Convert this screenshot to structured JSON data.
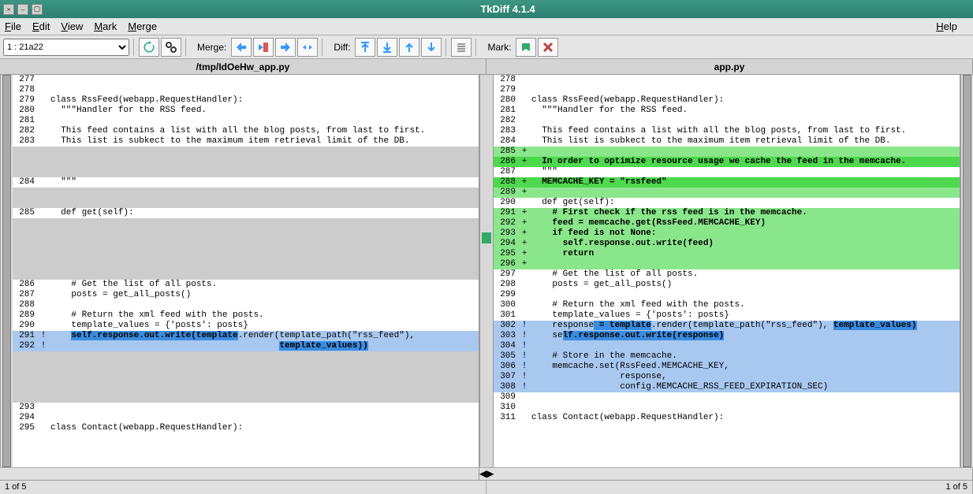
{
  "window": {
    "title": "TkDiff 4.1.4"
  },
  "menu": {
    "file": "File",
    "edit": "Edit",
    "view": "View",
    "mark": "Mark",
    "merge": "Merge",
    "help": "Help"
  },
  "toolbar": {
    "diff_selector": "1    : 21a22",
    "merge_label": "Merge:",
    "diff_label": "Diff:",
    "mark_label": "Mark:"
  },
  "files": {
    "left": "/tmp/IdOeHw_app.py",
    "right": "app.py"
  },
  "status": {
    "left": "1 of 5",
    "right": "1 of 5"
  },
  "left_lines": [
    {
      "n": "277",
      "m": "",
      "t": "",
      "bg": ""
    },
    {
      "n": "278",
      "m": "",
      "t": "",
      "bg": ""
    },
    {
      "n": "279",
      "m": "",
      "t": "class RssFeed(webapp.RequestHandler):",
      "bg": ""
    },
    {
      "n": "280",
      "m": "",
      "t": "  \"\"\"Handler for the RSS feed.",
      "bg": ""
    },
    {
      "n": "281",
      "m": "",
      "t": "",
      "bg": ""
    },
    {
      "n": "282",
      "m": "",
      "t": "  This feed contains a list with all the blog posts, from last to first.",
      "bg": ""
    },
    {
      "n": "283",
      "m": "",
      "t": "  This list is subkect to the maximum item retrieval limit of the DB.",
      "bg": ""
    },
    {
      "n": "",
      "m": "",
      "t": "",
      "bg": "bg-pad"
    },
    {
      "n": "",
      "m": "",
      "t": "",
      "bg": "bg-pad"
    },
    {
      "n": "",
      "m": "",
      "t": "",
      "bg": "bg-pad"
    },
    {
      "n": "284",
      "m": "",
      "t": "  \"\"\"",
      "bg": ""
    },
    {
      "n": "",
      "m": "",
      "t": "",
      "bg": "bg-pad"
    },
    {
      "n": "",
      "m": "",
      "t": "",
      "bg": "bg-pad"
    },
    {
      "n": "285",
      "m": "",
      "t": "  def get(self):",
      "bg": ""
    },
    {
      "n": "",
      "m": "",
      "t": "",
      "bg": "bg-pad"
    },
    {
      "n": "",
      "m": "",
      "t": "",
      "bg": "bg-pad"
    },
    {
      "n": "",
      "m": "",
      "t": "",
      "bg": "bg-pad"
    },
    {
      "n": "",
      "m": "",
      "t": "",
      "bg": "bg-pad"
    },
    {
      "n": "",
      "m": "",
      "t": "",
      "bg": "bg-pad"
    },
    {
      "n": "",
      "m": "",
      "t": "",
      "bg": "bg-pad"
    },
    {
      "n": "286",
      "m": "",
      "t": "    # Get the list of all posts.",
      "bg": ""
    },
    {
      "n": "287",
      "m": "",
      "t": "    posts = get_all_posts()",
      "bg": ""
    },
    {
      "n": "288",
      "m": "",
      "t": "",
      "bg": ""
    },
    {
      "n": "289",
      "m": "",
      "t": "    # Return the xml feed with the posts.",
      "bg": ""
    },
    {
      "n": "290",
      "m": "",
      "t": "    template_values = {'posts': posts}",
      "bg": ""
    },
    {
      "n": "291",
      "m": "!",
      "t": "",
      "bg": "bg-chg",
      "spans": [
        {
          "t": "    ",
          "c": ""
        },
        {
          "t": "self.response.out.write(template",
          "c": "hl-strong"
        },
        {
          "t": ".render(template_path(\"rss_feed\"),",
          "c": ""
        }
      ]
    },
    {
      "n": "292",
      "m": "!",
      "t": "",
      "bg": "bg-chg",
      "spans": [
        {
          "t": "                                            ",
          "c": ""
        },
        {
          "t": "template_values)",
          "c": "hl-strong"
        },
        {
          "t": ")",
          "c": "hl-strong"
        }
      ]
    },
    {
      "n": "",
      "m": "",
      "t": "",
      "bg": "bg-pad"
    },
    {
      "n": "",
      "m": "",
      "t": "",
      "bg": "bg-pad"
    },
    {
      "n": "",
      "m": "",
      "t": "",
      "bg": "bg-pad"
    },
    {
      "n": "",
      "m": "",
      "t": "",
      "bg": "bg-pad"
    },
    {
      "n": "",
      "m": "",
      "t": "",
      "bg": "bg-pad"
    },
    {
      "n": "293",
      "m": "",
      "t": "",
      "bg": ""
    },
    {
      "n": "294",
      "m": "",
      "t": "",
      "bg": ""
    },
    {
      "n": "295",
      "m": "",
      "t": "class Contact(webapp.RequestHandler):",
      "bg": ""
    }
  ],
  "right_lines": [
    {
      "n": "278",
      "m": "",
      "t": "",
      "bg": ""
    },
    {
      "n": "279",
      "m": "",
      "t": "",
      "bg": ""
    },
    {
      "n": "280",
      "m": "",
      "t": "class RssFeed(webapp.RequestHandler):",
      "bg": ""
    },
    {
      "n": "281",
      "m": "",
      "t": "  \"\"\"Handler for the RSS feed.",
      "bg": ""
    },
    {
      "n": "282",
      "m": "",
      "t": "",
      "bg": ""
    },
    {
      "n": "283",
      "m": "",
      "t": "  This feed contains a list with all the blog posts, from last to first.",
      "bg": ""
    },
    {
      "n": "284",
      "m": "",
      "t": "  This list is subkect to the maximum item retrieval limit of the DB.",
      "bg": ""
    },
    {
      "n": "285",
      "m": "+",
      "t": "",
      "bg": "bg-add"
    },
    {
      "n": "286",
      "m": "+",
      "t": "  In order to optimize resource usage we cache the feed in the memcache.",
      "bg": "bg-add-strong",
      "bold": true
    },
    {
      "n": "287",
      "m": "",
      "t": "  \"\"\"",
      "bg": ""
    },
    {
      "n": "288",
      "m": "+",
      "t": "  MEMCACHE_KEY = \"rssfeed\"",
      "bg": "bg-add-strong",
      "bold": true
    },
    {
      "n": "289",
      "m": "+",
      "t": "",
      "bg": "bg-add"
    },
    {
      "n": "290",
      "m": "",
      "t": "  def get(self):",
      "bg": ""
    },
    {
      "n": "291",
      "m": "+",
      "t": "    # First check if the rss feed is in the memcache.",
      "bg": "bg-add",
      "bold": true
    },
    {
      "n": "292",
      "m": "+",
      "t": "    feed = memcache.get(RssFeed.MEMCACHE_KEY)",
      "bg": "bg-add",
      "bold": true
    },
    {
      "n": "293",
      "m": "+",
      "t": "    if feed is not None:",
      "bg": "bg-add",
      "bold": true
    },
    {
      "n": "294",
      "m": "+",
      "t": "      self.response.out.write(feed)",
      "bg": "bg-add",
      "bold": true
    },
    {
      "n": "295",
      "m": "+",
      "t": "      return",
      "bg": "bg-add",
      "bold": true
    },
    {
      "n": "296",
      "m": "+",
      "t": "",
      "bg": "bg-add"
    },
    {
      "n": "297",
      "m": "",
      "t": "    # Get the list of all posts.",
      "bg": ""
    },
    {
      "n": "298",
      "m": "",
      "t": "    posts = get_all_posts()",
      "bg": ""
    },
    {
      "n": "299",
      "m": "",
      "t": "",
      "bg": ""
    },
    {
      "n": "300",
      "m": "",
      "t": "    # Return the xml feed with the posts.",
      "bg": ""
    },
    {
      "n": "301",
      "m": "",
      "t": "    template_values = {'posts': posts}",
      "bg": ""
    },
    {
      "n": "302",
      "m": "!",
      "t": "",
      "bg": "bg-chg",
      "spans": [
        {
          "t": "    response",
          "c": ""
        },
        {
          "t": " = template",
          "c": "hl-strong"
        },
        {
          "t": ".render(template_path(\"rss_feed\"), ",
          "c": ""
        },
        {
          "t": "template_values)",
          "c": "hl-strong"
        }
      ]
    },
    {
      "n": "303",
      "m": "!",
      "t": "",
      "bg": "bg-chg",
      "spans": [
        {
          "t": "    se",
          "c": ""
        },
        {
          "t": "lf.re",
          "c": "hl-strong"
        },
        {
          "t": "sponse.out.write(response)",
          "c": "hl-strong"
        }
      ]
    },
    {
      "n": "304",
      "m": "!",
      "t": "",
      "bg": "bg-chg"
    },
    {
      "n": "305",
      "m": "!",
      "t": "    # Store in the memcache.",
      "bg": "bg-chg"
    },
    {
      "n": "306",
      "m": "!",
      "t": "    memcache.set(RssFeed.MEMCACHE_KEY,",
      "bg": "bg-chg"
    },
    {
      "n": "307",
      "m": "!",
      "t": "                 response,",
      "bg": "bg-chg"
    },
    {
      "n": "308",
      "m": "!",
      "t": "                 config.MEMCACHE_RSS_FEED_EXPIRATION_SEC)",
      "bg": "bg-chg"
    },
    {
      "n": "309",
      "m": "",
      "t": "",
      "bg": ""
    },
    {
      "n": "310",
      "m": "",
      "t": "",
      "bg": ""
    },
    {
      "n": "311",
      "m": "",
      "t": "class Contact(webapp.RequestHandler):",
      "bg": ""
    }
  ]
}
